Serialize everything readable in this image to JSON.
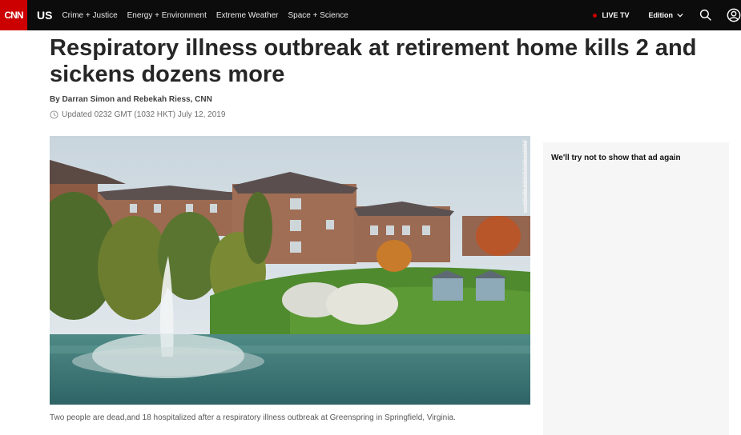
{
  "nav": {
    "logo": "CNN",
    "section": "US",
    "links": [
      "Crime + Justice",
      "Energy + Environment",
      "Extreme Weather",
      "Space + Science"
    ],
    "live_tv": "LIVE TV",
    "edition": "Edition",
    "colors": {
      "bar": "#0c0c0c",
      "logo_bg": "#cc0000"
    }
  },
  "article": {
    "headline": "Respiratory illness outbreak at retirement home kills 2 and sickens dozens more",
    "byline": "By Darran Simon and Rebekah Riess, CNN",
    "updated": "Updated 0232 GMT (1032 HKT) July 12, 2019",
    "photo_credit": "FROM ERICKSON LIVING",
    "caption": "Two people are dead,and 18 hospitalized after a respiratory illness outbreak at Greenspring in Springfield, Virginia."
  },
  "ad": {
    "message": "We'll try not to show that ad again"
  }
}
